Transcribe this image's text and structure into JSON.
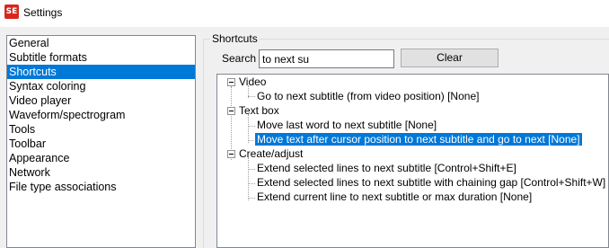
{
  "window": {
    "title": "Settings",
    "icon": "subtitle-edit-app-icon",
    "icon_text": "SE",
    "icon_color": "#d9261c"
  },
  "sidebar": {
    "items": [
      {
        "label": "General"
      },
      {
        "label": "Subtitle formats"
      },
      {
        "label": "Shortcuts",
        "selected": true
      },
      {
        "label": "Syntax coloring"
      },
      {
        "label": "Video player"
      },
      {
        "label": "Waveform/spectrogram"
      },
      {
        "label": "Tools"
      },
      {
        "label": "Toolbar"
      },
      {
        "label": "Appearance"
      },
      {
        "label": "Network"
      },
      {
        "label": "File type associations"
      }
    ]
  },
  "shortcuts": {
    "group_title": "Shortcuts",
    "search_label": "Search",
    "search_value": "to next su",
    "clear_label": "Clear",
    "tree": [
      {
        "label": "Video",
        "children": [
          {
            "label": "Go to next subtitle (from video position) [None]"
          }
        ]
      },
      {
        "label": "Text box",
        "children": [
          {
            "label": "Move last word to next subtitle [None]"
          },
          {
            "label": "Move text after cursor position to next subtitle and go to next [None]",
            "selected": true
          }
        ]
      },
      {
        "label": "Create/adjust",
        "children": [
          {
            "label": "Extend selected lines to next subtitle [Control+Shift+E]"
          },
          {
            "label": "Extend selected lines to next subtitle with chaining gap [Control+Shift+W]"
          },
          {
            "label": "Extend current line to next subtitle or max duration [None]"
          }
        ]
      }
    ]
  },
  "colors": {
    "selection": "#0078d7",
    "window_bg": "#f0f0f0"
  }
}
